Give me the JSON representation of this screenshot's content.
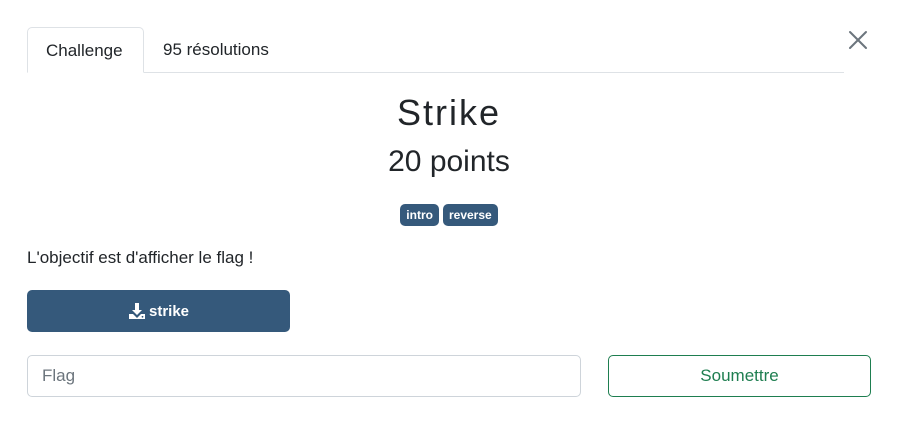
{
  "tabs": [
    {
      "label": "Challenge",
      "active": true
    },
    {
      "label": "95 résolutions",
      "active": false
    }
  ],
  "challenge": {
    "title": "Strike",
    "points": "20 points",
    "tags": [
      "intro",
      "reverse"
    ],
    "description": "L'objectif est d'afficher le flag !"
  },
  "download": {
    "label": "strike",
    "icon": "download-icon"
  },
  "flag_input": {
    "placeholder": "Flag",
    "value": ""
  },
  "submit": {
    "label": "Soumettre"
  },
  "close": {
    "icon": "close-icon"
  },
  "colors": {
    "primary": "#35597b",
    "success": "#1e7e50",
    "border": "#dee2e6"
  }
}
